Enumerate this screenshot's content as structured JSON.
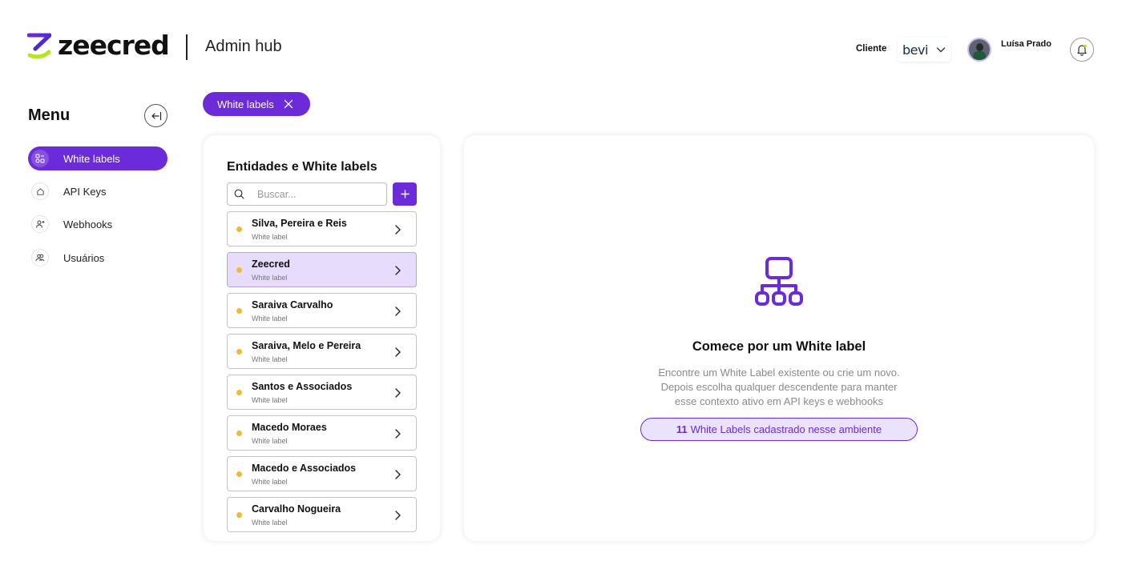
{
  "header": {
    "logo_text": "zeecred",
    "hub_title": "Admin hub",
    "client_label": "Cliente",
    "client_name": "bevi",
    "user_name": "Luísa Prado"
  },
  "sidebar": {
    "title": "Menu",
    "items": [
      {
        "label": "White labels",
        "icon": "white-labels-icon",
        "active": true
      },
      {
        "label": "API Keys",
        "icon": "home-icon",
        "active": false
      },
      {
        "label": "Webhooks",
        "icon": "user-plus-icon",
        "active": false
      },
      {
        "label": "Usuários",
        "icon": "users-icon",
        "active": false
      }
    ]
  },
  "filter_chip": {
    "label": "White labels"
  },
  "list_panel": {
    "title": "Entidades e White labels",
    "search_placeholder": "Buscar...",
    "entities": [
      {
        "name": "Silva, Pereira e Reis",
        "type": "White label",
        "selected": false
      },
      {
        "name": "Zeecred",
        "type": "White label",
        "selected": true
      },
      {
        "name": "Saraiva Carvalho",
        "type": "White label",
        "selected": false
      },
      {
        "name": "Saraiva, Melo e Pereira",
        "type": "White label",
        "selected": false
      },
      {
        "name": "Santos e Associados",
        "type": "White label",
        "selected": false
      },
      {
        "name": "Macedo Moraes",
        "type": "White label",
        "selected": false
      },
      {
        "name": "Macedo e Associados",
        "type": "White label",
        "selected": false
      },
      {
        "name": "Carvalho Nogueira",
        "type": "White label",
        "selected": false
      }
    ]
  },
  "detail_panel": {
    "title": "Comece por um White label",
    "description_lines": [
      "Encontre um White Label existente ou crie um novo.",
      "Depois escolha qualquer descendente para manter",
      "esse contexto ativo em API keys e webhooks"
    ],
    "count": "11",
    "count_text": "White Labels cadastrado nesse ambiente"
  },
  "colors": {
    "accent": "#6c2bd9",
    "selected_bg": "#e7dcfb",
    "status_dot": "#f5b82e",
    "logo_green": "#b4e61e"
  }
}
